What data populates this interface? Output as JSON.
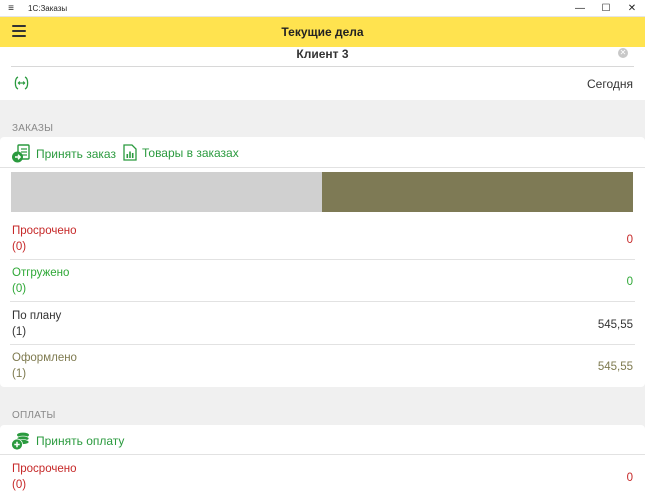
{
  "window": {
    "title": "1С:Заказы",
    "menu_glyph": "≡",
    "minimize_glyph": "—",
    "maximize_glyph": "☐",
    "close_glyph": "✕"
  },
  "appbar": {
    "title": "Текущие дела"
  },
  "client": {
    "name": "Клиент 3",
    "clear_glyph": "✕"
  },
  "period": {
    "label": "Сегодня",
    "icon": "calendar-range-icon"
  },
  "orders": {
    "section_title": "ЗАКАЗЫ",
    "actions": [
      {
        "label": "Принять заказ",
        "icon": "accept-order-icon"
      },
      {
        "label": "Товары в заказах",
        "icon": "chart-document-icon"
      }
    ],
    "bar": {
      "grey_fraction": 0.5,
      "olive_fraction": 0.5,
      "grey_color": "#d0d0d0",
      "olive_color": "#7e7a55"
    },
    "stats": [
      {
        "label": "Просрочено",
        "count": "(0)",
        "value": "0",
        "color": "#c62828"
      },
      {
        "label": "Отгружено",
        "count": "(0)",
        "value": "0",
        "color": "#2ea836"
      },
      {
        "label": "По плану",
        "count": "(1)",
        "value": "545,55",
        "color": "#333333"
      },
      {
        "label": "Оформлено",
        "count": "(1)",
        "value": "545,55",
        "color": "#7e7a4f"
      }
    ]
  },
  "payments": {
    "section_title": "ОПЛАТЫ",
    "actions": [
      {
        "label": "Принять оплату",
        "icon": "accept-payment-icon"
      }
    ],
    "stats": [
      {
        "label": "Просрочено",
        "count": "(0)",
        "value": "0",
        "color": "#c62828"
      }
    ]
  },
  "colors": {
    "accent_yellow": "#ffe34f",
    "action_green": "#2a9a3e"
  }
}
